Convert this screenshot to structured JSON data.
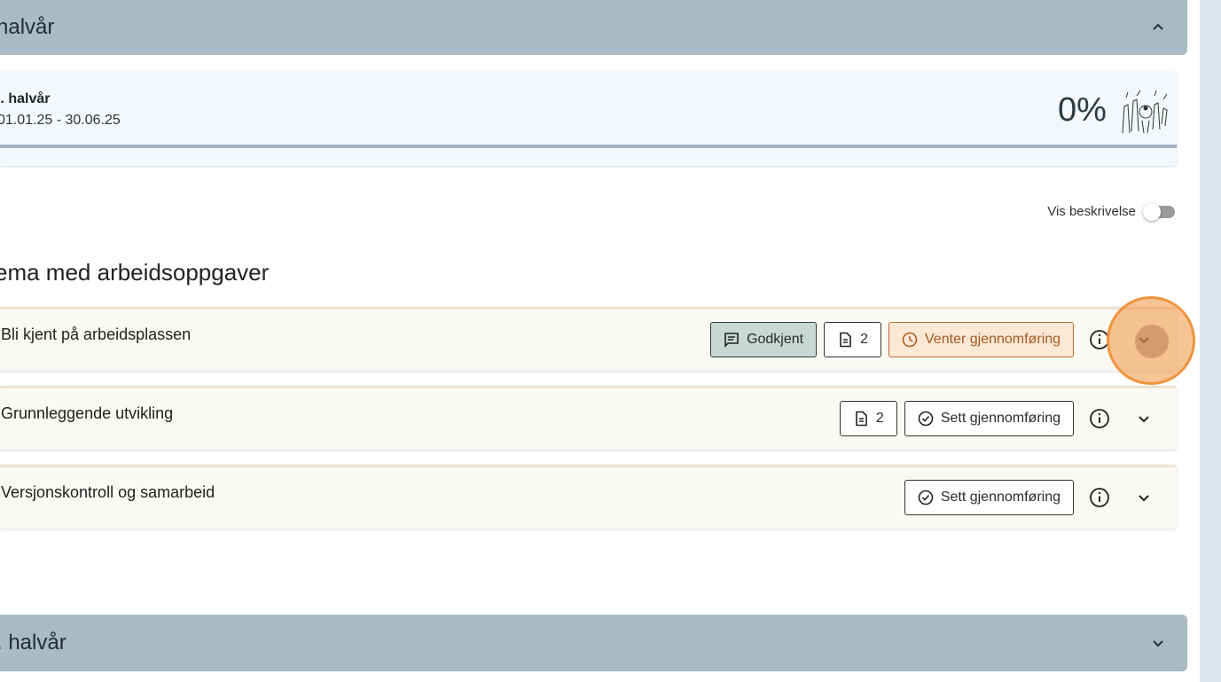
{
  "sections": {
    "first": {
      "title": "halvår"
    },
    "second": {
      "title": ". halvår"
    }
  },
  "period": {
    "name": "l. halvår",
    "dates": "01.01.25 - 30.06.25",
    "percent": "0%",
    "progress_fraction": 0
  },
  "toggle": {
    "label": "Vis beskrivelse",
    "on": false
  },
  "heading": "ema med arbeidsoppgaver",
  "tasks": [
    {
      "title": "Bli kjent på arbeidsplassen",
      "approved_label": "Godkjent",
      "doc_count": "2",
      "status_label": "Venter gjennomføring"
    },
    {
      "title": "Grunnleggende utvikling",
      "doc_count": "2",
      "status_label": "Sett gjennomføring"
    },
    {
      "title": "Versjonskontroll og samarbeid",
      "status_label": "Sett gjennomføring"
    }
  ],
  "icons": {
    "comment": "comment-icon",
    "document": "document-icon",
    "clock": "clock-icon",
    "check-circle": "check-circle-icon",
    "info": "info-icon",
    "chevron-down": "chevron-down-icon",
    "chevron-up": "chevron-up-icon"
  },
  "colors": {
    "header_bg": "#a8bbc6",
    "approved_bg": "#c7d8d5",
    "waiting_bg": "#fbe8d5",
    "waiting_border": "#c06c2c",
    "highlight": "#f0943e"
  }
}
